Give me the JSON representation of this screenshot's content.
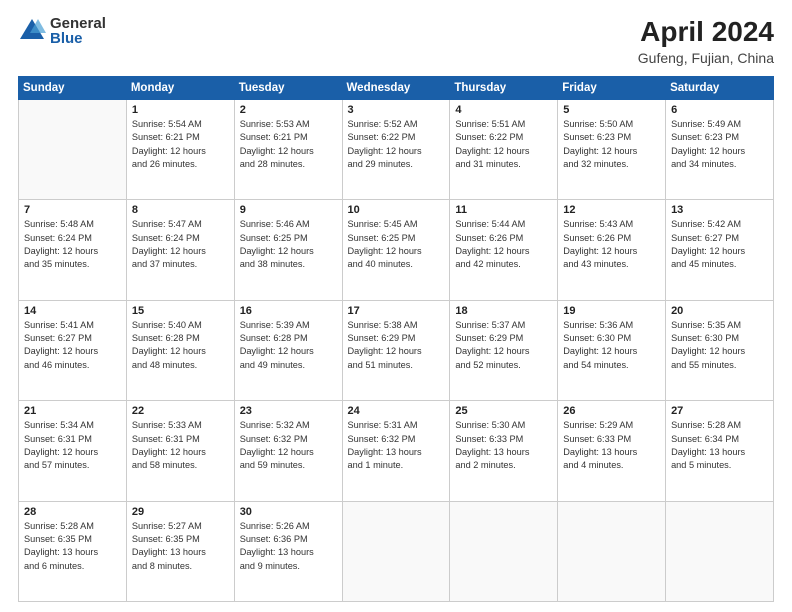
{
  "logo": {
    "general": "General",
    "blue": "Blue"
  },
  "title": "April 2024",
  "subtitle": "Gufeng, Fujian, China",
  "days_header": [
    "Sunday",
    "Monday",
    "Tuesday",
    "Wednesday",
    "Thursday",
    "Friday",
    "Saturday"
  ],
  "weeks": [
    [
      {
        "num": "",
        "info": ""
      },
      {
        "num": "1",
        "info": "Sunrise: 5:54 AM\nSunset: 6:21 PM\nDaylight: 12 hours\nand 26 minutes."
      },
      {
        "num": "2",
        "info": "Sunrise: 5:53 AM\nSunset: 6:21 PM\nDaylight: 12 hours\nand 28 minutes."
      },
      {
        "num": "3",
        "info": "Sunrise: 5:52 AM\nSunset: 6:22 PM\nDaylight: 12 hours\nand 29 minutes."
      },
      {
        "num": "4",
        "info": "Sunrise: 5:51 AM\nSunset: 6:22 PM\nDaylight: 12 hours\nand 31 minutes."
      },
      {
        "num": "5",
        "info": "Sunrise: 5:50 AM\nSunset: 6:23 PM\nDaylight: 12 hours\nand 32 minutes."
      },
      {
        "num": "6",
        "info": "Sunrise: 5:49 AM\nSunset: 6:23 PM\nDaylight: 12 hours\nand 34 minutes."
      }
    ],
    [
      {
        "num": "7",
        "info": "Sunrise: 5:48 AM\nSunset: 6:24 PM\nDaylight: 12 hours\nand 35 minutes."
      },
      {
        "num": "8",
        "info": "Sunrise: 5:47 AM\nSunset: 6:24 PM\nDaylight: 12 hours\nand 37 minutes."
      },
      {
        "num": "9",
        "info": "Sunrise: 5:46 AM\nSunset: 6:25 PM\nDaylight: 12 hours\nand 38 minutes."
      },
      {
        "num": "10",
        "info": "Sunrise: 5:45 AM\nSunset: 6:25 PM\nDaylight: 12 hours\nand 40 minutes."
      },
      {
        "num": "11",
        "info": "Sunrise: 5:44 AM\nSunset: 6:26 PM\nDaylight: 12 hours\nand 42 minutes."
      },
      {
        "num": "12",
        "info": "Sunrise: 5:43 AM\nSunset: 6:26 PM\nDaylight: 12 hours\nand 43 minutes."
      },
      {
        "num": "13",
        "info": "Sunrise: 5:42 AM\nSunset: 6:27 PM\nDaylight: 12 hours\nand 45 minutes."
      }
    ],
    [
      {
        "num": "14",
        "info": "Sunrise: 5:41 AM\nSunset: 6:27 PM\nDaylight: 12 hours\nand 46 minutes."
      },
      {
        "num": "15",
        "info": "Sunrise: 5:40 AM\nSunset: 6:28 PM\nDaylight: 12 hours\nand 48 minutes."
      },
      {
        "num": "16",
        "info": "Sunrise: 5:39 AM\nSunset: 6:28 PM\nDaylight: 12 hours\nand 49 minutes."
      },
      {
        "num": "17",
        "info": "Sunrise: 5:38 AM\nSunset: 6:29 PM\nDaylight: 12 hours\nand 51 minutes."
      },
      {
        "num": "18",
        "info": "Sunrise: 5:37 AM\nSunset: 6:29 PM\nDaylight: 12 hours\nand 52 minutes."
      },
      {
        "num": "19",
        "info": "Sunrise: 5:36 AM\nSunset: 6:30 PM\nDaylight: 12 hours\nand 54 minutes."
      },
      {
        "num": "20",
        "info": "Sunrise: 5:35 AM\nSunset: 6:30 PM\nDaylight: 12 hours\nand 55 minutes."
      }
    ],
    [
      {
        "num": "21",
        "info": "Sunrise: 5:34 AM\nSunset: 6:31 PM\nDaylight: 12 hours\nand 57 minutes."
      },
      {
        "num": "22",
        "info": "Sunrise: 5:33 AM\nSunset: 6:31 PM\nDaylight: 12 hours\nand 58 minutes."
      },
      {
        "num": "23",
        "info": "Sunrise: 5:32 AM\nSunset: 6:32 PM\nDaylight: 12 hours\nand 59 minutes."
      },
      {
        "num": "24",
        "info": "Sunrise: 5:31 AM\nSunset: 6:32 PM\nDaylight: 13 hours\nand 1 minute."
      },
      {
        "num": "25",
        "info": "Sunrise: 5:30 AM\nSunset: 6:33 PM\nDaylight: 13 hours\nand 2 minutes."
      },
      {
        "num": "26",
        "info": "Sunrise: 5:29 AM\nSunset: 6:33 PM\nDaylight: 13 hours\nand 4 minutes."
      },
      {
        "num": "27",
        "info": "Sunrise: 5:28 AM\nSunset: 6:34 PM\nDaylight: 13 hours\nand 5 minutes."
      }
    ],
    [
      {
        "num": "28",
        "info": "Sunrise: 5:28 AM\nSunset: 6:35 PM\nDaylight: 13 hours\nand 6 minutes."
      },
      {
        "num": "29",
        "info": "Sunrise: 5:27 AM\nSunset: 6:35 PM\nDaylight: 13 hours\nand 8 minutes."
      },
      {
        "num": "30",
        "info": "Sunrise: 5:26 AM\nSunset: 6:36 PM\nDaylight: 13 hours\nand 9 minutes."
      },
      {
        "num": "",
        "info": ""
      },
      {
        "num": "",
        "info": ""
      },
      {
        "num": "",
        "info": ""
      },
      {
        "num": "",
        "info": ""
      }
    ]
  ]
}
